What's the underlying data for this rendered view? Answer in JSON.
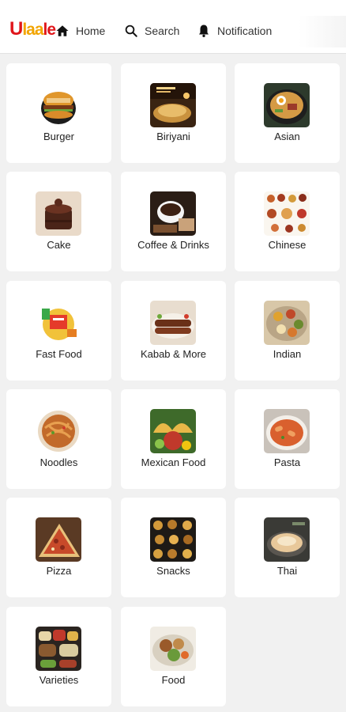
{
  "header": {
    "logo_text": "Ulaale",
    "nav": [
      {
        "label": "Home",
        "icon": "home-icon"
      },
      {
        "label": "Search",
        "icon": "search-icon"
      },
      {
        "label": "Notification",
        "icon": "bell-icon"
      }
    ]
  },
  "categories": [
    {
      "label": "Burger"
    },
    {
      "label": "Biriyani"
    },
    {
      "label": "Asian"
    },
    {
      "label": "Cake"
    },
    {
      "label": "Coffee & Drinks"
    },
    {
      "label": "Chinese"
    },
    {
      "label": "Fast Food"
    },
    {
      "label": "Kabab & More"
    },
    {
      "label": "Indian"
    },
    {
      "label": "Noodles"
    },
    {
      "label": "Mexican Food"
    },
    {
      "label": "Pasta"
    },
    {
      "label": "Pizza"
    },
    {
      "label": "Snacks"
    },
    {
      "label": "Thai"
    },
    {
      "label": "Varieties"
    },
    {
      "label": "Food"
    }
  ],
  "colors": {
    "brand_red": "#e0161b",
    "brand_yellow": "#f2a400",
    "card_bg": "#ffffff",
    "page_bg": "#f1f1f1"
  }
}
